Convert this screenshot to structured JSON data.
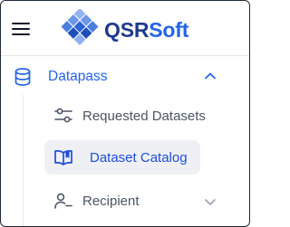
{
  "brand": {
    "part1": "QSR",
    "part2": "Soft",
    "primary_color": "#1e3a8a",
    "accent_color": "#2563eb"
  },
  "menu": {
    "icon": "hamburger-menu-icon"
  },
  "section": {
    "label": "Datapass",
    "icon": "database-icon",
    "expanded": true,
    "items": [
      {
        "label": "Requested Datasets",
        "icon": "sliders-icon",
        "active": false
      },
      {
        "label": "Dataset Catalog",
        "icon": "open-book-icon",
        "active": true
      },
      {
        "label": "Recipient",
        "icon": "user-minus-icon",
        "active": false,
        "expandable": true
      }
    ]
  },
  "colors": {
    "active_text": "#1d4ed8",
    "active_bg": "#eef0f3",
    "inactive_text": "#4b5563"
  }
}
